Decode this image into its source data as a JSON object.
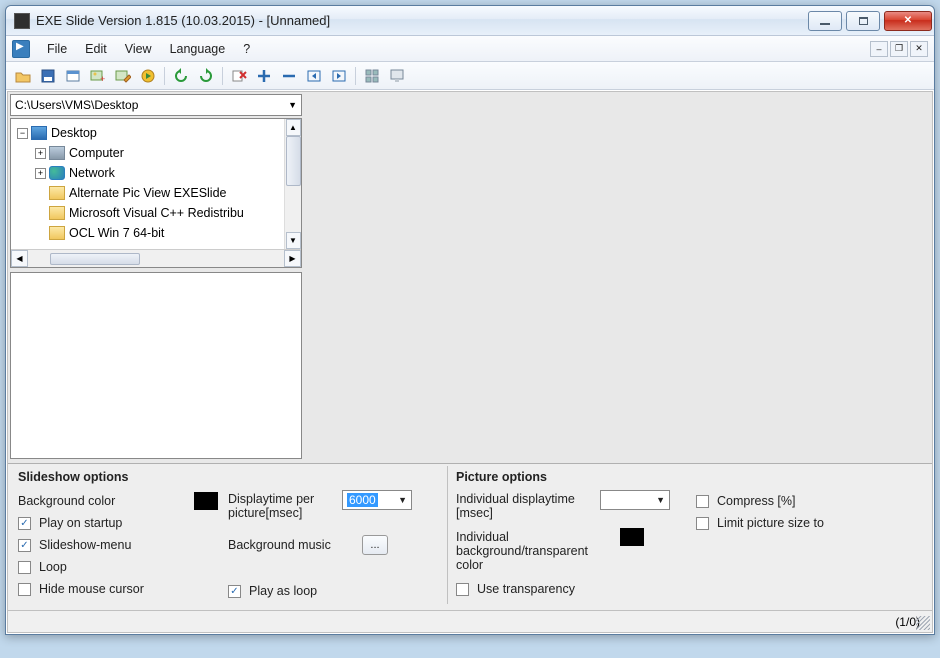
{
  "window": {
    "title": "EXE Slide Version 1.815 (10.03.2015) - [Unnamed]"
  },
  "menu": {
    "items": [
      "File",
      "Edit",
      "View",
      "Language",
      "?"
    ]
  },
  "toolbar_icons": [
    "open-icon",
    "save-icon",
    "window-icon",
    "picture-add-icon",
    "picture-edit-icon",
    "play-icon",
    "sep",
    "rotate-left-icon",
    "rotate-right-icon",
    "sep",
    "remove-icon",
    "add-icon",
    "subtract-icon",
    "left-icon",
    "right-icon",
    "sep",
    "grid-icon",
    "screen-icon"
  ],
  "path": {
    "value": "C:\\Users\\VMS\\Desktop"
  },
  "tree": {
    "nodes": [
      {
        "indent": 0,
        "expand": "minus",
        "icon": "desktop",
        "label": "Desktop"
      },
      {
        "indent": 1,
        "expand": "plus",
        "icon": "computer",
        "label": "Computer"
      },
      {
        "indent": 1,
        "expand": "plus",
        "icon": "network",
        "label": "Network"
      },
      {
        "indent": 1,
        "expand": "none",
        "icon": "folder",
        "label": "Alternate Pic View EXESlide"
      },
      {
        "indent": 1,
        "expand": "none",
        "icon": "folder",
        "label": "Microsoft Visual C++ Redistribu"
      },
      {
        "indent": 1,
        "expand": "none",
        "icon": "folder",
        "label": "OCL Win 7 64-bit"
      }
    ]
  },
  "slideshow": {
    "title": "Slideshow options",
    "bg_label": "Background color",
    "bg_color": "#000000",
    "play_startup": {
      "label": "Play on startup",
      "checked": true
    },
    "menu_opt": {
      "label": "Slideshow-menu",
      "checked": true
    },
    "loop": {
      "label": "Loop",
      "checked": false
    },
    "hide_cursor": {
      "label": "Hide mouse cursor",
      "checked": false
    },
    "displaytime_label": "Displaytime per picture[msec]",
    "displaytime_value": "6000",
    "bgmusic_label": "Background music",
    "play_as_loop": {
      "label": "Play as loop",
      "checked": true
    }
  },
  "picture": {
    "title": "Picture options",
    "ind_display_label": "Individual displaytime [msec]",
    "ind_display_value": "",
    "ind_bg_label": "Individual background/transparent color",
    "ind_bg_color": "#000000",
    "use_transparency": {
      "label": "Use transparency",
      "checked": false
    },
    "compress": {
      "label": "Compress [%]",
      "checked": false
    },
    "limit_size": {
      "label": "Limit picture size to",
      "checked": false
    }
  },
  "status": {
    "text": "(1/0)"
  }
}
